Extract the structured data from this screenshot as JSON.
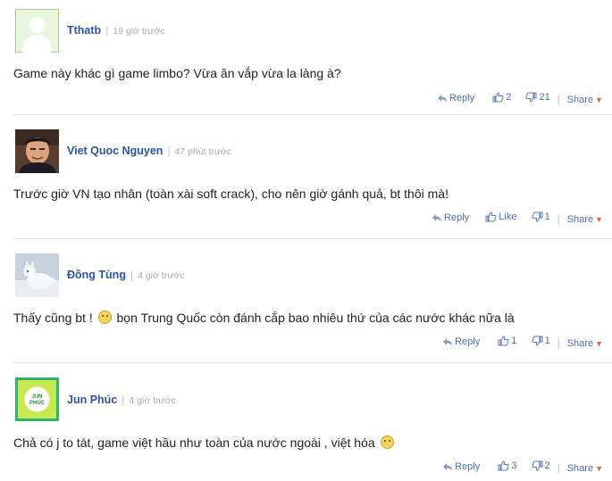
{
  "comments": [
    {
      "author": "Tthatb",
      "time": "19 giờ trước",
      "text": "Game này khác gì game limbo? Vừa ăn vắp vừa la làng à?",
      "reply_label": "Reply",
      "likes": "2",
      "dislikes": "21",
      "share_label": "Share",
      "avatar": "default-silhouette"
    },
    {
      "author": "Viet Quoc Nguyen",
      "time": "47 phút trước",
      "text": "Trước giờ VN tạo nhân (toàn xài soft crack), cho nên giờ gánh quả, bt thôi mà!",
      "reply_label": "Reply",
      "likes": "Like",
      "dislikes": "1",
      "share_label": "Share",
      "avatar": "photo-man"
    },
    {
      "author": "Đồng Tùng",
      "time": "4 giờ trước",
      "text_before": "Thấy cũng bt !",
      "emoji": "wink-emoji",
      "text_after": "bọn Trung Quốc còn đánh cắp bao nhiêu thứ của các nước khác nữa là",
      "reply_label": "Reply",
      "likes": "1",
      "dislikes": "1",
      "share_label": "Share",
      "avatar": "photo-snow-fox"
    },
    {
      "author": "Jun Phúc",
      "time": "4 giờ trước",
      "text": "Chả có j to tát, game việt hầu như toàn của nước ngoài , việt hóa",
      "emoji": "grin-emoji",
      "reply_label": "Reply",
      "likes": "3",
      "dislikes": "2",
      "share_label": "Share",
      "avatar": "logo-jun-phuc",
      "avatar_text": "JUN PHÚC"
    }
  ],
  "colors": {
    "author": "#2b55a3",
    "action": "#4a6fb3",
    "time": "#a8a8a8",
    "caret": "#e8642c"
  }
}
